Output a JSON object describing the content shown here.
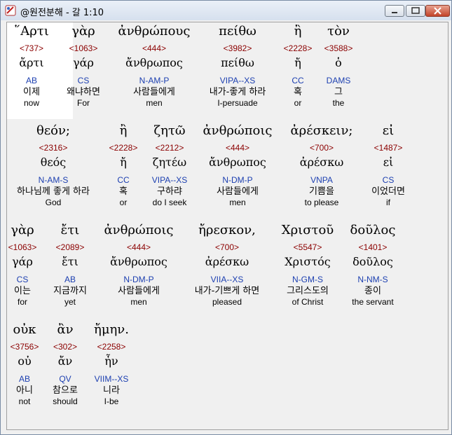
{
  "window": {
    "title": "@원전분해 - 갈 1:10",
    "controls": {
      "minimize": "minimize-icon",
      "maximize": "maximize-icon",
      "close": "close-icon"
    }
  },
  "lines": [
    {
      "words": [
        {
          "greek": "῞Αρτι",
          "strong": "<737>",
          "lemma": "ἄρτι",
          "parse": "AB",
          "korean": "이제",
          "english": "now"
        },
        {
          "greek": "γὰρ",
          "strong": "<1063>",
          "lemma": "γάρ",
          "parse": "CS",
          "korean": "왜냐하면",
          "english": "For"
        },
        {
          "greek": "ἀνθρώπους",
          "strong": "<444>",
          "lemma": "ἄνθρωπος",
          "parse": "N-AM-P",
          "korean": "사람들에게",
          "english": "men"
        },
        {
          "greek": "πείθω",
          "strong": "<3982>",
          "lemma": "πείθω",
          "parse": "VIPA--XS",
          "korean": "내가-좋게 하라",
          "english": "I-persuade"
        },
        {
          "greek": "ἢ",
          "strong": "<2228>",
          "lemma": "ἤ",
          "parse": "CC",
          "korean": "혹",
          "english": "or"
        },
        {
          "greek": "τὸν",
          "strong": "<3588>",
          "lemma": "ὁ",
          "parse": "DAMS",
          "korean": "그",
          "english": "the"
        }
      ]
    },
    {
      "words": [
        {
          "greek": "θεόν;",
          "strong": "<2316>",
          "lemma": "θεός",
          "parse": "N-AM-S",
          "korean": "하나님께 좋게 하라",
          "english": "God"
        },
        {
          "greek": "ἢ",
          "strong": "<2228>",
          "lemma": "ἤ",
          "parse": "CC",
          "korean": "혹",
          "english": "or"
        },
        {
          "greek": "ζητῶ",
          "strong": "<2212>",
          "lemma": "ζητέω",
          "parse": "VIPA--XS",
          "korean": "구하랴",
          "english": "do I seek"
        },
        {
          "greek": "ἀνθρώποις",
          "strong": "<444>",
          "lemma": "ἄνθρωπος",
          "parse": "N-DM-P",
          "korean": "사람들에게",
          "english": "men"
        },
        {
          "greek": "ἀρέσκειν;",
          "strong": "<700>",
          "lemma": "ἀρέσκω",
          "parse": "VNPA",
          "korean": "기쁨을",
          "english": "to please"
        },
        {
          "greek": "εἰ",
          "strong": "<1487>",
          "lemma": "εἰ",
          "parse": "CS",
          "korean": "이었더면",
          "english": "if"
        }
      ]
    },
    {
      "words": [
        {
          "greek": "γὰρ",
          "strong": "<1063>",
          "lemma": "γάρ",
          "parse": "CS",
          "korean": "이는",
          "english": "for"
        },
        {
          "greek": "ἔτι",
          "strong": "<2089>",
          "lemma": "ἔτι",
          "parse": "AB",
          "korean": "지금까지",
          "english": "yet"
        },
        {
          "greek": "ἀνθρώποις",
          "strong": "<444>",
          "lemma": "ἄνθρωπος",
          "parse": "N-DM-P",
          "korean": "사람들에게",
          "english": "men"
        },
        {
          "greek": "ἤρεσκον,",
          "strong": "<700>",
          "lemma": "ἀρέσκω",
          "parse": "VIIA--XS",
          "korean": "내가-기쁘게 하면",
          "english": "pleased"
        },
        {
          "greek": "Χριστοῦ",
          "strong": "<5547>",
          "lemma": "Χριστός",
          "parse": "N-GM-S",
          "korean": "그리스도의",
          "english": "of Christ"
        },
        {
          "greek": "δοῦλος",
          "strong": "<1401>",
          "lemma": "δοῦλος",
          "parse": "N-NM-S",
          "korean": "종이",
          "english": "the servant"
        }
      ]
    },
    {
      "words": [
        {
          "greek": "οὐκ",
          "strong": "<3756>",
          "lemma": "οὐ",
          "parse": "AB",
          "korean": "아니",
          "english": "not"
        },
        {
          "greek": "ἂν",
          "strong": "<302>",
          "lemma": "ἄν",
          "parse": "QV",
          "korean": "참으로",
          "english": "should"
        },
        {
          "greek": "ἤμην.",
          "strong": "<2258>",
          "lemma": "ἦν",
          "parse": "VIIM--XS",
          "korean": "니라",
          "english": "I-be"
        }
      ]
    }
  ]
}
